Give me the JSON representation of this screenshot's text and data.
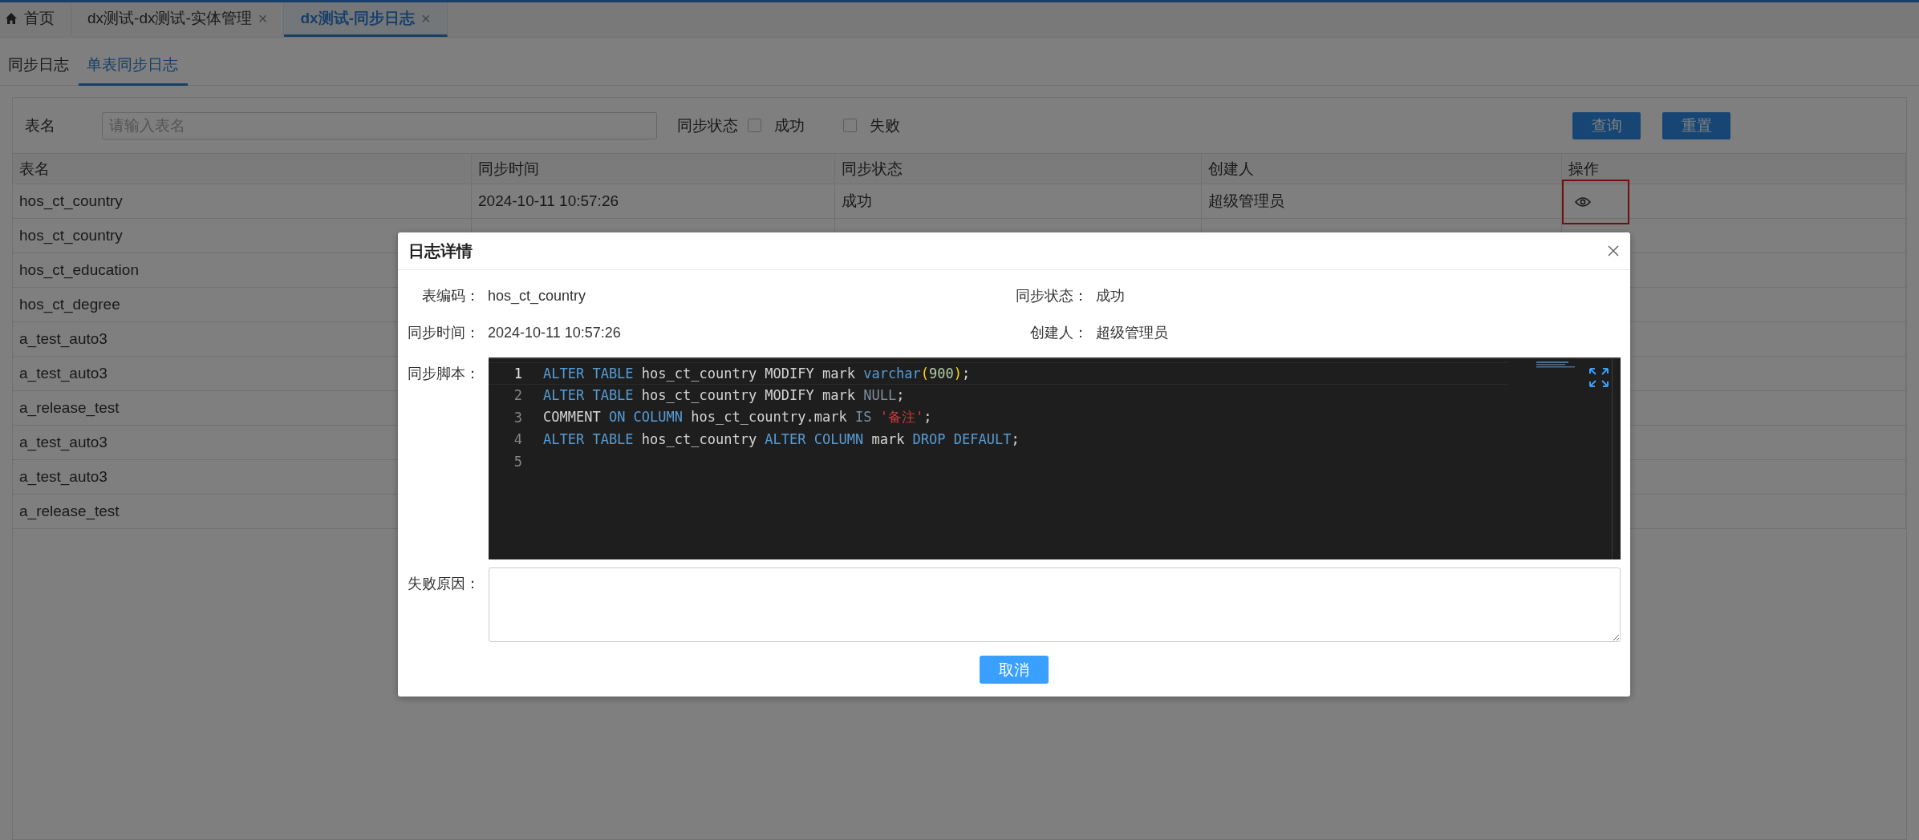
{
  "tabs": [
    {
      "label": "首页",
      "kind": "home",
      "closable": false,
      "selected": false
    },
    {
      "label": "dx测试-dx测试-实体管理",
      "kind": "page",
      "closable": true,
      "selected": false
    },
    {
      "label": "dx测试-同步日志",
      "kind": "page",
      "closable": true,
      "selected": true
    }
  ],
  "close_mark": "×",
  "subtabs": [
    {
      "label": "同步日志",
      "selected": false
    },
    {
      "label": "单表同步日志",
      "selected": true
    }
  ],
  "filters": {
    "name_label": "表名",
    "name_placeholder": "请输入表名",
    "status_label": "同步状态",
    "status_options": [
      {
        "label": "成功",
        "checked": false
      },
      {
        "label": "失败",
        "checked": false
      }
    ],
    "buttons": [
      "查询",
      "重置"
    ]
  },
  "table": {
    "columns": [
      "表名",
      "同步时间",
      "同步状态",
      "创建人",
      "操作"
    ],
    "rows": [
      {
        "cells": [
          "hos_ct_country",
          "2024-10-11 10:57:26",
          "成功",
          "超级管理员"
        ],
        "kind": "view",
        "highlighted": true
      },
      {
        "cells": [
          "hos_ct_country"
        ]
      },
      {
        "cells": [
          "hos_ct_education"
        ]
      },
      {
        "cells": [
          "hos_ct_degree"
        ]
      },
      {
        "cells": [
          "a_test_auto3"
        ]
      },
      {
        "cells": [
          "a_test_auto3"
        ]
      },
      {
        "cells": [
          "a_release_test"
        ]
      },
      {
        "cells": [
          "a_test_auto3"
        ]
      },
      {
        "cells": [
          "a_test_auto3"
        ]
      },
      {
        "cells": [
          "a_release_test"
        ]
      }
    ]
  },
  "dialog": {
    "title": "日志详情",
    "fields": [
      [
        {
          "label": "表编码：",
          "value": "hos_ct_country"
        },
        {
          "label": "同步状态：",
          "value": "成功"
        }
      ],
      [
        {
          "label": "同步时间：",
          "value": "2024-10-11 10:57:26"
        },
        {
          "label": "创建人：",
          "value": "超级管理员"
        }
      ]
    ],
    "script_label": "同步脚本：",
    "code": [
      {
        "number": "1",
        "current": true,
        "tokens": [
          {
            "kind": "keyword",
            "text": "ALTER TABLE"
          },
          {
            "kind": "plain",
            "text": " hos_ct_country MODIFY mark "
          },
          {
            "kind": "keyword",
            "text": "varchar"
          },
          {
            "kind": "bracket",
            "text": "("
          },
          {
            "kind": "number",
            "text": "900"
          },
          {
            "kind": "bracket",
            "text": ")"
          },
          {
            "kind": "plain",
            "text": ";"
          }
        ]
      },
      {
        "number": "2",
        "current": false,
        "tokens": [
          {
            "kind": "keyword",
            "text": "ALTER TABLE"
          },
          {
            "kind": "plain",
            "text": " hos_ct_country MODIFY mark "
          },
          {
            "kind": "null",
            "text": "NULL"
          },
          {
            "kind": "plain",
            "text": ";"
          }
        ]
      },
      {
        "number": "3",
        "current": false,
        "tokens": [
          {
            "kind": "plain",
            "text": "COMMENT "
          },
          {
            "kind": "keyword",
            "text": "ON COLUMN"
          },
          {
            "kind": "plain",
            "text": " hos_ct_country.mark "
          },
          {
            "kind": "null",
            "text": "IS "
          },
          {
            "kind": "string",
            "text": "'备注'"
          },
          {
            "kind": "plain",
            "text": ";"
          }
        ]
      },
      {
        "number": "4",
        "current": false,
        "tokens": [
          {
            "kind": "keyword",
            "text": "ALTER TABLE"
          },
          {
            "kind": "plain",
            "text": " hos_ct_country "
          },
          {
            "kind": "keyword",
            "text": "ALTER COLUMN"
          },
          {
            "kind": "plain",
            "text": " mark "
          },
          {
            "kind": "keyword",
            "text": "DROP DEFAULT"
          },
          {
            "kind": "plain",
            "text": ";"
          }
        ]
      },
      {
        "number": "5",
        "current": false
      }
    ],
    "reason_label": "失败原因：",
    "cancel": "取消"
  }
}
